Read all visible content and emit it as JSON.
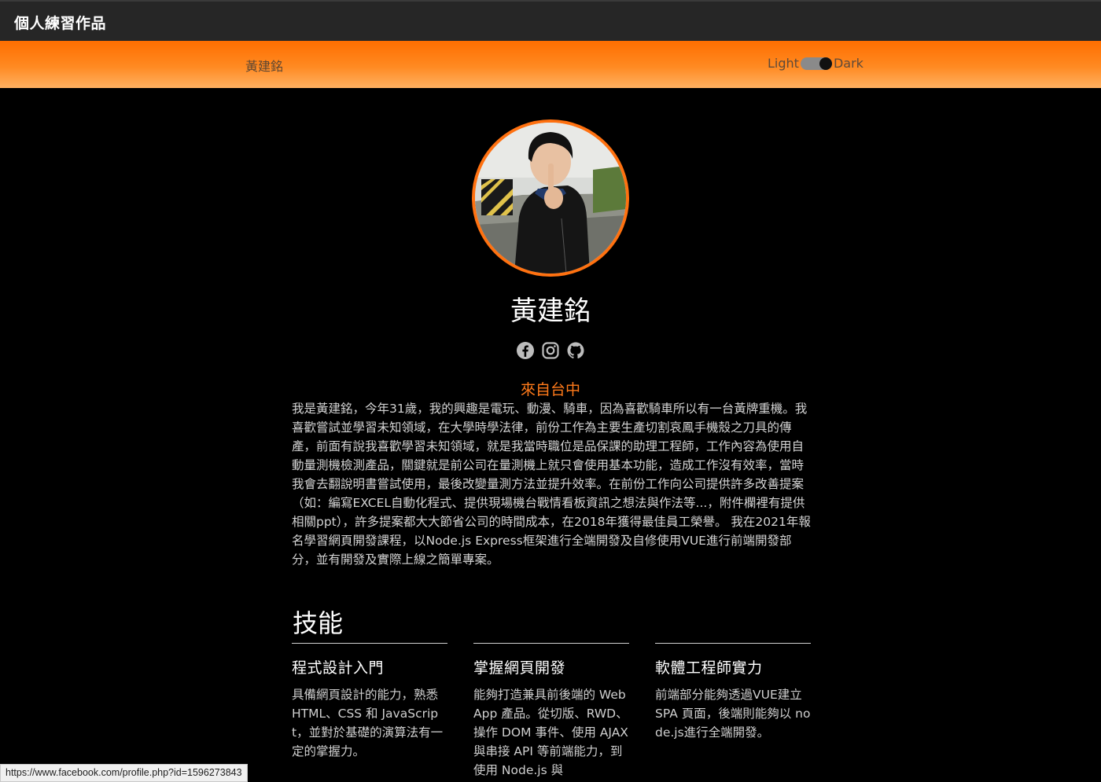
{
  "header": {
    "brand": "個人練習作品"
  },
  "nav": {
    "name_link": "黃建銘",
    "theme": {
      "light_label": "Light",
      "dark_label": "Dark",
      "state": "dark"
    }
  },
  "profile": {
    "name": "黃建銘",
    "socials": [
      {
        "icon": "facebook-icon"
      },
      {
        "icon": "instagram-icon"
      },
      {
        "icon": "github-icon"
      }
    ],
    "from": "來自台中",
    "bio": "我是黃建銘，今年31歲，我的興趣是電玩、動漫、騎車，因為喜歡騎車所以有一台黃牌重機。我喜歡嘗試並學習未知領域，在大學時學法律，前份工作為主要生產切割哀鳳手機殼之刀具的傳產，前面有說我喜歡學習未知領域，就是我當時職位是品保課的助理工程師，工作內容為使用自動量測機檢測產品，關鍵就是前公司在量測機上就只會使用基本功能，造成工作沒有效率，當時我會去翻說明書嘗試使用，最後改變量測方法並提升效率。在前份工作向公司提供許多改善提案（如：編寫EXCEL自動化程式、提供現場機台戰情看板資訊之想法與作法等...，附件欄裡有提供相關ppt），許多提案都大大節省公司的時間成本，在2018年獲得最佳員工榮譽。 我在2021年報名學習網頁開發課程，以Node.js Express框架進行全端開發及自修使用VUE進行前端開發部分，並有開發及實際上線之簡單專案。"
  },
  "skills": {
    "title": "技能",
    "items": [
      {
        "title": "程式設計入門",
        "desc": "具備網頁設計的能力，熟悉 HTML、CSS 和 JavaScript，並對於基礎的演算法有一定的掌握力。"
      },
      {
        "title": "掌握網頁開發",
        "desc": "能夠打造兼具前後端的 Web App 產品。從切版、RWD、操作 DOM 事件、使用 AJAX 與串接 API 等前端能力，到使用 Node.js 與"
      },
      {
        "title": "軟體工程師實力",
        "desc": "前端部分能夠透過VUE建立 SPA 頁面，後端則能夠以 node.js進行全端開發。"
      }
    ]
  },
  "status_bar": {
    "url": "https://www.facebook.com/profile.php?id=1596273843"
  },
  "colors": {
    "accent": "#ff7110",
    "header_bg": "#262626",
    "page_bg": "#000000"
  }
}
